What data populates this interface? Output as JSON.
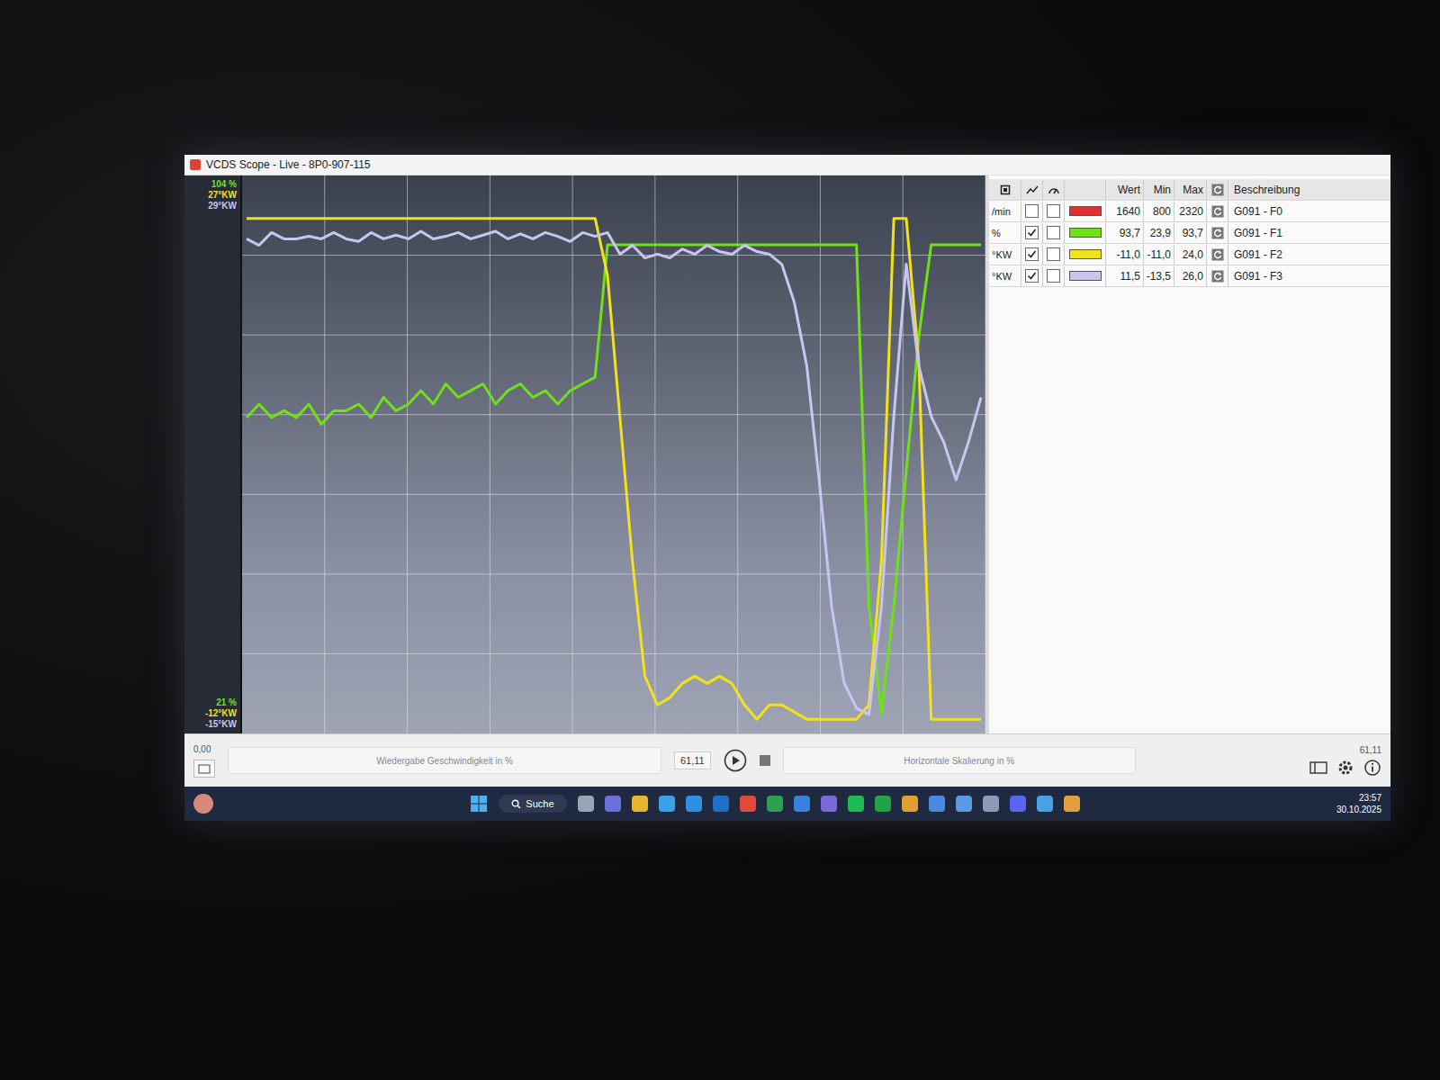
{
  "window": {
    "title": "VCDS Scope - Live - 8P0-907-115"
  },
  "table": {
    "columns": [
      "Wert",
      "Min",
      "Max",
      "Beschreibung"
    ],
    "rows": [
      {
        "unit": "/min",
        "chart": false,
        "gauge": false,
        "color": "#e03030",
        "value": "1640",
        "min": "800",
        "max": "2320",
        "description": "G091 - F0",
        "scale_min": 800,
        "scale_max": 2320,
        "values": []
      },
      {
        "unit": "%",
        "chart": true,
        "gauge": false,
        "color": "#6fe01a",
        "value": "93,7",
        "min": "23,9",
        "max": "93,7",
        "description": "G091 - F1",
        "top_label": "104 %",
        "bottom_label": "21 %",
        "scale_min": 21,
        "scale_max": 104,
        "values": [
          68,
          70,
          68,
          69,
          68,
          70,
          67,
          69,
          69,
          70,
          68,
          71,
          69,
          70,
          72,
          70,
          73,
          71,
          72,
          73,
          70,
          72,
          73,
          71,
          72,
          70,
          72,
          73,
          74,
          93.7,
          93.7,
          93.7,
          93.7,
          93.7,
          93.7,
          93.7,
          93.7,
          93.7,
          93.7,
          93.7,
          93.7,
          93.7,
          93.7,
          93.7,
          93.7,
          93.7,
          93.7,
          93.7,
          93.7,
          93.7,
          40,
          24,
          40,
          60,
          80,
          93.7,
          93.7,
          93.7,
          93.7,
          93.7
        ]
      },
      {
        "unit": "°KW",
        "chart": true,
        "gauge": false,
        "color": "#f2e21c",
        "value": "-11,0",
        "min": "-11,0",
        "max": "24,0",
        "description": "G091 - F2",
        "top_label": "27°KW",
        "bottom_label": "-12°KW",
        "scale_min": -12,
        "scale_max": 27,
        "values": [
          24,
          24,
          24,
          24,
          24,
          24,
          24,
          24,
          24,
          24,
          24,
          24,
          24,
          24,
          24,
          24,
          24,
          24,
          24,
          24,
          24,
          24,
          24,
          24,
          24,
          24,
          24,
          24,
          24,
          20,
          10,
          0,
          -8,
          -10,
          -9.5,
          -8.5,
          -8,
          -8.5,
          -8,
          -8.5,
          -10,
          -11,
          -10,
          -10,
          -10.5,
          -11,
          -11,
          -11,
          -11,
          -11,
          -10,
          0,
          24,
          24,
          14,
          -11,
          -11,
          -11,
          -11,
          -11
        ]
      },
      {
        "unit": "°KW",
        "chart": true,
        "gauge": false,
        "color": "#c8c6f0",
        "value": "11,5",
        "min": "-13,5",
        "max": "26,0",
        "description": "G091 - F3",
        "top_label": "29°KW",
        "bottom_label": "-15°KW",
        "scale_min": -15,
        "scale_max": 29,
        "values": [
          24,
          23.5,
          24.5,
          24,
          24,
          24.2,
          24,
          24.5,
          24,
          23.8,
          24.5,
          24,
          24.3,
          24,
          24.6,
          24,
          24.2,
          24.5,
          24,
          24.3,
          24.6,
          24,
          24.4,
          24,
          24.5,
          24.2,
          23.8,
          24.5,
          24.2,
          24.5,
          22.8,
          23.5,
          22.5,
          22.8,
          22.5,
          23.2,
          22.8,
          23.5,
          23,
          22.8,
          23.5,
          23,
          22.8,
          22,
          19,
          14,
          5,
          -5,
          -11,
          -13,
          -13.5,
          -5,
          10,
          22,
          14,
          10,
          8,
          5,
          8,
          11.5
        ]
      }
    ]
  },
  "controls": {
    "position": "0,00",
    "speed_label": "Wiedergabe Geschwindigkeit in %",
    "speed_value": "61,11",
    "scale_label": "Horizontale Skalierung in %",
    "scale_value": "61,11"
  },
  "taskbar": {
    "search": "Suche",
    "time": "23:57",
    "date": "30.10.2025",
    "apps": [
      {
        "color": "#9aa3b5"
      },
      {
        "color": "#6b6fd8"
      },
      {
        "color": "#e8b530"
      },
      {
        "color": "#3aa0e8"
      },
      {
        "color": "#2f8fe0"
      },
      {
        "color": "#1f6fc8"
      },
      {
        "color": "#e04a3a"
      },
      {
        "color": "#2e9e4f"
      },
      {
        "color": "#3a7fd8"
      },
      {
        "color": "#7a6ad8"
      },
      {
        "color": "#1db954"
      },
      {
        "color": "#25a244"
      },
      {
        "color": "#e0a030"
      },
      {
        "color": "#4a8ae0"
      },
      {
        "color": "#5a9ae0"
      },
      {
        "color": "#8a9ab8"
      },
      {
        "color": "#5865f2"
      },
      {
        "color": "#4aa0e0"
      },
      {
        "color": "#e0a040"
      }
    ]
  }
}
